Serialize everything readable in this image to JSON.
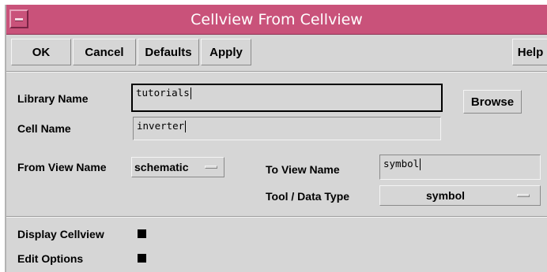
{
  "window": {
    "title": "Cellview From Cellview",
    "menu_icon": "window-menu-icon"
  },
  "buttons": {
    "ok": "OK",
    "cancel": "Cancel",
    "defaults": "Defaults",
    "apply": "Apply",
    "help": "Help",
    "browse": "Browse"
  },
  "form": {
    "library_name_label": "Library Name",
    "library_name_value": "tutorials",
    "cell_name_label": "Cell Name",
    "cell_name_value": "inverter",
    "from_view_label": "From View Name",
    "from_view_value": "schematic",
    "to_view_label": "To View Name",
    "to_view_value": "symbol",
    "tool_data_type_label": "Tool / Data Type",
    "tool_data_type_value": "symbol"
  },
  "options": {
    "display_cellview_label": "Display Cellview",
    "display_cellview_checked": true,
    "edit_options_label": "Edit Options",
    "edit_options_checked": true
  },
  "colors": {
    "titlebar": "#c9527a",
    "panel": "#d6d6d6"
  }
}
